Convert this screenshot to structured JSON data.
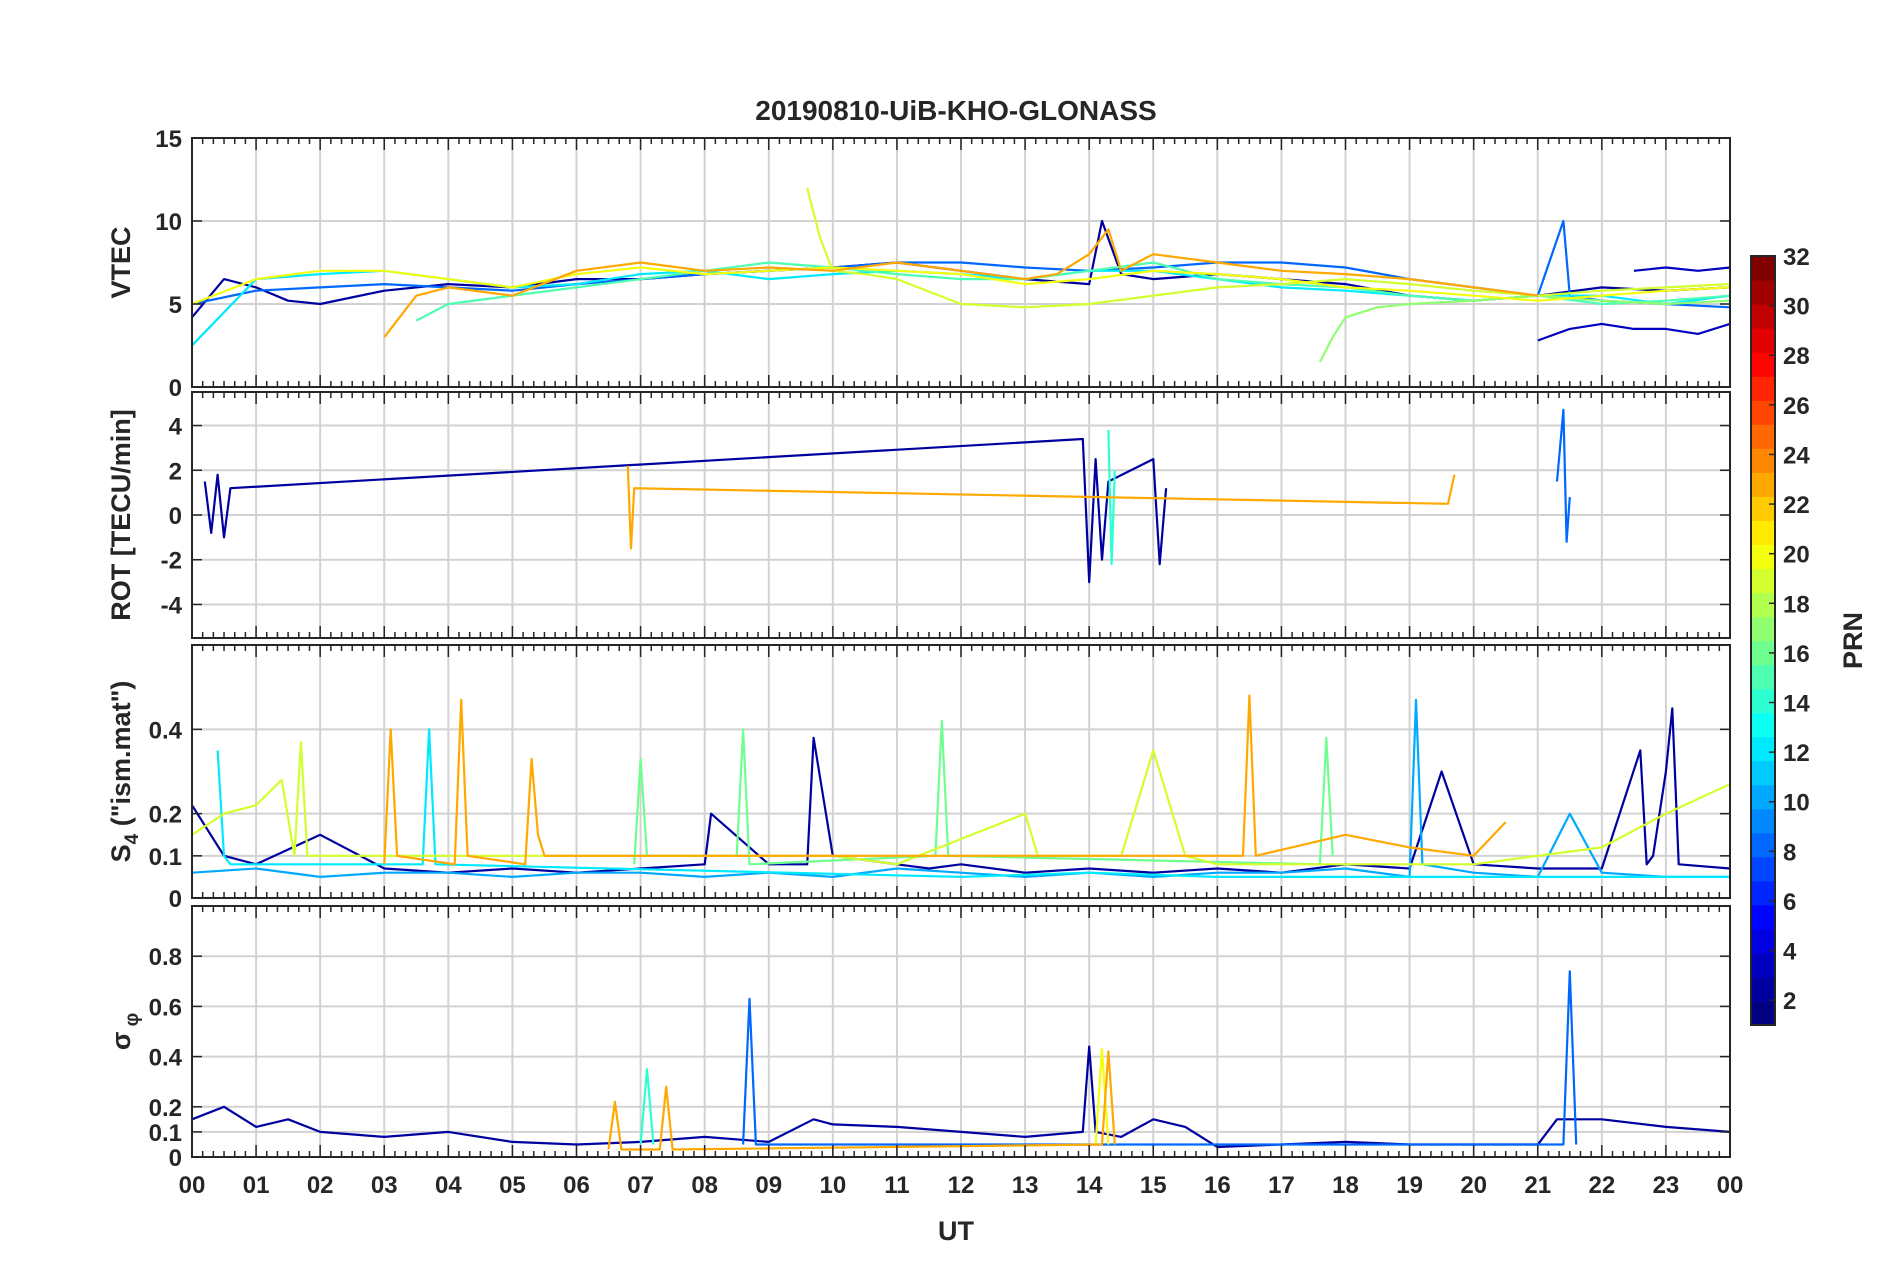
{
  "chart_data": {
    "type": "line",
    "title": "20190810-UiB-KHO-GLONASS",
    "xlabel": "UT",
    "x_ticks": [
      "00",
      "01",
      "02",
      "03",
      "04",
      "05",
      "06",
      "07",
      "08",
      "09",
      "10",
      "11",
      "12",
      "13",
      "14",
      "15",
      "16",
      "17",
      "18",
      "19",
      "20",
      "21",
      "22",
      "23",
      "00"
    ],
    "xlim": [
      0,
      24
    ],
    "grid": true,
    "colorbar": {
      "label": "PRN",
      "colormap": "jet",
      "range": [
        1,
        32
      ],
      "ticks": [
        "2",
        "4",
        "6",
        "8",
        "10",
        "12",
        "14",
        "16",
        "18",
        "20",
        "22",
        "24",
        "26",
        "28",
        "30",
        "32"
      ]
    },
    "panels": [
      {
        "id": "vtec",
        "ylabel": "VTEC",
        "ylim": [
          0,
          15
        ],
        "y_ticks": [
          "0",
          "5",
          "10",
          "15"
        ],
        "series": [
          {
            "prn": 2,
            "x": [
              0,
              0.5,
              1,
              1.5,
              2,
              3,
              4,
              5,
              6,
              7,
              8,
              9,
              10,
              11,
              12,
              13,
              14,
              14.2,
              14.5,
              15,
              16,
              17,
              18,
              19,
              20,
              21,
              22,
              23,
              24
            ],
            "y": [
              4.2,
              6.5,
              6,
              5.2,
              5,
              5.8,
              6.2,
              6,
              6.5,
              6.5,
              6.8,
              7,
              7.2,
              7.5,
              7,
              6.5,
              6.2,
              10,
              6.8,
              6.5,
              6.8,
              6.5,
              6.2,
              5.5,
              5.2,
              5.5,
              6,
              5.8,
              6
            ]
          },
          {
            "prn": 3,
            "x": [
              21,
              21.5,
              22,
              22.5,
              23,
              23.5,
              24
            ],
            "y": [
              2.8,
              3.5,
              3.8,
              3.5,
              3.5,
              3.2,
              3.8
            ]
          },
          {
            "prn": 3,
            "x": [
              22.5,
              23,
              23.5,
              24
            ],
            "y": [
              7,
              7.2,
              7,
              7.2
            ]
          },
          {
            "prn": 8,
            "x": [
              0,
              1,
              2,
              3,
              4,
              5,
              6,
              7,
              8,
              9,
              10,
              11,
              12,
              13,
              14,
              15,
              16,
              17,
              18,
              19,
              20,
              21,
              21.4,
              21.5,
              22,
              23,
              24
            ],
            "y": [
              5,
              5.8,
              6,
              6.2,
              6,
              5.8,
              6.2,
              6.5,
              6.8,
              7,
              7.2,
              7.5,
              7.5,
              7.2,
              7,
              7.2,
              7.5,
              7.5,
              7.2,
              6.5,
              6,
              5.5,
              10,
              5.5,
              5.2,
              5,
              4.8
            ]
          },
          {
            "prn": 12,
            "x": [
              0,
              0.5,
              1,
              2,
              3,
              4,
              5,
              6,
              7,
              8,
              9,
              10,
              11,
              12,
              13,
              14,
              15,
              16,
              17,
              18,
              19,
              20,
              21,
              22,
              23,
              24
            ],
            "y": [
              2.5,
              4.5,
              6.5,
              6.8,
              7,
              6.5,
              6,
              6.2,
              6.8,
              7,
              6.5,
              6.8,
              7,
              6.8,
              6.5,
              7,
              7,
              6.5,
              6,
              5.8,
              5.5,
              5.2,
              5.5,
              5.5,
              5,
              5.5
            ]
          },
          {
            "prn": 15,
            "x": [
              3.5,
              4,
              5,
              6,
              7,
              8,
              9,
              10,
              11,
              12,
              13,
              14,
              15,
              16,
              17,
              18,
              19,
              20,
              21,
              22,
              23,
              24
            ],
            "y": [
              4,
              5,
              5.5,
              6,
              6.5,
              7,
              7.5,
              7.2,
              6.8,
              6.5,
              6.5,
              7,
              7.5,
              6.5,
              6.2,
              6,
              5.5,
              5.2,
              5.5,
              5,
              5.2,
              5.5
            ]
          },
          {
            "prn": 17,
            "x": [
              17.6,
              17.8,
              18,
              18.5,
              19,
              20,
              21,
              22,
              23,
              24
            ],
            "y": [
              1.5,
              3,
              4.2,
              4.8,
              5,
              5.2,
              5.5,
              5.2,
              5,
              5.2
            ]
          },
          {
            "prn": 19,
            "x": [
              9.6,
              9.8,
              10,
              10.5,
              11,
              12,
              13,
              14,
              15,
              16,
              17,
              18,
              19,
              20,
              21,
              22,
              23,
              24
            ],
            "y": [
              12,
              9,
              7,
              6.8,
              6.5,
              5,
              4.8,
              5,
              5.5,
              6,
              6.2,
              6.5,
              6.2,
              5.8,
              5.5,
              5.8,
              6,
              6.2
            ]
          },
          {
            "prn": 20,
            "x": [
              0,
              1,
              2,
              3,
              4,
              5,
              6,
              7,
              8,
              9,
              10,
              11,
              12,
              13,
              14,
              15,
              16,
              17,
              18,
              19,
              20,
              21,
              22,
              23,
              24
            ],
            "y": [
              5,
              6.5,
              7,
              7,
              6.5,
              6,
              6.8,
              7.2,
              6.8,
              7,
              7.2,
              7,
              6.8,
              6.2,
              6.5,
              7,
              6.8,
              6.5,
              6,
              5.8,
              5.5,
              5.2,
              5.5,
              5.8,
              6
            ]
          },
          {
            "prn": 23,
            "x": [
              3,
              3.5,
              4,
              5,
              6,
              7,
              8,
              9,
              10,
              11,
              12,
              13,
              13.5,
              14,
              14.3,
              14.5,
              15,
              16,
              17,
              18,
              19,
              20,
              21
            ],
            "y": [
              3,
              5.5,
              6,
              5.5,
              7,
              7.5,
              7,
              7.2,
              7,
              7.5,
              7,
              6.5,
              6.8,
              8,
              9.5,
              7,
              8,
              7.5,
              7,
              6.8,
              6.5,
              6,
              5.5
            ]
          }
        ]
      },
      {
        "id": "rot",
        "ylabel": "ROT [TECU/min]",
        "ylim": [
          -5.5,
          5.5
        ],
        "y_ticks": [
          "-4",
          "-2",
          "0",
          "2",
          "4"
        ],
        "series": [
          {
            "prn": 2,
            "x": [
              0.2,
              0.3,
              0.4,
              0.5,
              0.6,
              13.9,
              14,
              14.1,
              14.2,
              14.3,
              15,
              15.1,
              15.2
            ],
            "y": [
              1.5,
              -0.8,
              1.8,
              -1,
              1.2,
              3.4,
              -3,
              2.5,
              -2,
              1.5,
              2.5,
              -2.2,
              1.2
            ]
          },
          {
            "prn": 8,
            "x": [
              21.3,
              21.4,
              21.45,
              21.5
            ],
            "y": [
              1.5,
              4.7,
              -1.2,
              0.8
            ]
          },
          {
            "prn": 14,
            "x": [
              14.3,
              14.35,
              14.4
            ],
            "y": [
              3.8,
              -2.2,
              2
            ]
          },
          {
            "prn": 23,
            "x": [
              6.8,
              6.85,
              6.9,
              19.6,
              19.7
            ],
            "y": [
              2.2,
              -1.5,
              1.2,
              0.5,
              1.8
            ]
          }
        ]
      },
      {
        "id": "s4",
        "ylabel": "S4 (\"ism.mat\")",
        "ylim": [
          0,
          0.6
        ],
        "y_ticks": [
          "0",
          "0.1",
          "0.2",
          "0.4"
        ],
        "series": [
          {
            "prn": 2,
            "x": [
              0,
              0.5,
              1,
              2,
              3,
              4,
              5,
              6,
              7,
              8,
              8.1,
              9,
              9.6,
              9.7,
              10,
              11,
              11.5,
              12,
              13,
              14,
              15,
              16,
              17,
              18,
              19,
              19.5,
              20,
              21,
              22,
              22.6,
              22.7,
              22.8,
              23,
              23.1,
              23.2,
              24
            ],
            "y": [
              0.22,
              0.1,
              0.08,
              0.15,
              0.07,
              0.06,
              0.07,
              0.06,
              0.07,
              0.08,
              0.2,
              0.08,
              0.08,
              0.38,
              0.1,
              0.08,
              0.07,
              0.08,
              0.06,
              0.07,
              0.06,
              0.07,
              0.06,
              0.08,
              0.07,
              0.3,
              0.08,
              0.07,
              0.07,
              0.35,
              0.08,
              0.1,
              0.3,
              0.45,
              0.08,
              0.07
            ]
          },
          {
            "prn": 10,
            "x": [
              0,
              1,
              2,
              3,
              4,
              5,
              6,
              7,
              8,
              9,
              10,
              11,
              12,
              13,
              14,
              15,
              16,
              17,
              18,
              19,
              19.1,
              19.2,
              20,
              21,
              21.5,
              22,
              23,
              24
            ],
            "y": [
              0.06,
              0.07,
              0.05,
              0.06,
              0.06,
              0.05,
              0.06,
              0.06,
              0.05,
              0.06,
              0.05,
              0.07,
              0.06,
              0.05,
              0.06,
              0.05,
              0.06,
              0.06,
              0.07,
              0.05,
              0.47,
              0.08,
              0.06,
              0.05,
              0.2,
              0.06,
              0.05,
              0.05
            ]
          },
          {
            "prn": 12,
            "x": [
              0.4,
              0.5,
              0.6,
              3.6,
              3.7,
              3.8,
              12,
              14,
              16,
              18,
              20,
              22,
              24
            ],
            "y": [
              0.35,
              0.1,
              0.08,
              0.08,
              0.4,
              0.08,
              0.05,
              0.06,
              0.05,
              0.05,
              0.05,
              0.05,
              0.05
            ]
          },
          {
            "prn": 16,
            "x": [
              6.9,
              7,
              7.1,
              8.5,
              8.6,
              8.7,
              11.6,
              11.7,
              11.8,
              17.6,
              17.7,
              17.8
            ],
            "y": [
              0.08,
              0.33,
              0.1,
              0.1,
              0.4,
              0.08,
              0.1,
              0.42,
              0.1,
              0.08,
              0.38,
              0.1
            ]
          },
          {
            "prn": 19,
            "x": [
              0,
              0.5,
              1,
              1.4,
              1.6,
              1.7,
              1.8,
              10,
              11,
              12,
              13,
              13.2,
              14.5,
              15,
              15.5,
              16,
              20,
              22,
              23,
              24
            ],
            "y": [
              0.15,
              0.2,
              0.22,
              0.28,
              0.1,
              0.37,
              0.1,
              0.1,
              0.08,
              0.14,
              0.2,
              0.1,
              0.1,
              0.35,
              0.1,
              0.08,
              0.08,
              0.12,
              0.2,
              0.27
            ]
          },
          {
            "prn": 23,
            "x": [
              3,
              3.1,
              3.2,
              4.1,
              4.2,
              4.3,
              5.2,
              5.3,
              5.4,
              5.5,
              16.4,
              16.5,
              16.6,
              18,
              19,
              20,
              20.5
            ],
            "y": [
              0.08,
              0.4,
              0.1,
              0.08,
              0.47,
              0.1,
              0.08,
              0.33,
              0.15,
              0.1,
              0.1,
              0.48,
              0.1,
              0.15,
              0.12,
              0.1,
              0.18
            ]
          }
        ]
      },
      {
        "id": "sigma_phi",
        "ylabel": "σφ",
        "ylim": [
          0,
          1
        ],
        "y_ticks": [
          "0",
          "0.1",
          "0.2",
          "0.4",
          "0.6",
          "0.8"
        ],
        "series": [
          {
            "prn": 2,
            "x": [
              0,
              0.5,
              1,
              1.5,
              2,
              3,
              4,
              5,
              6,
              7,
              8,
              9,
              9.7,
              10,
              11,
              12,
              13,
              13.9,
              14,
              14.1,
              14.5,
              15,
              15.5,
              16,
              17,
              18,
              19,
              20,
              21,
              21.3,
              22,
              23,
              24
            ],
            "y": [
              0.15,
              0.2,
              0.12,
              0.15,
              0.1,
              0.08,
              0.1,
              0.06,
              0.05,
              0.06,
              0.08,
              0.06,
              0.15,
              0.13,
              0.12,
              0.1,
              0.08,
              0.1,
              0.44,
              0.1,
              0.08,
              0.15,
              0.12,
              0.04,
              0.05,
              0.06,
              0.05,
              0.05,
              0.05,
              0.15,
              0.15,
              0.12,
              0.1
            ]
          },
          {
            "prn": 8,
            "x": [
              8.6,
              8.7,
              8.8,
              21.4,
              21.5,
              21.6
            ],
            "y": [
              0.05,
              0.63,
              0.05,
              0.05,
              0.74,
              0.05
            ]
          },
          {
            "prn": 14,
            "x": [
              7,
              7.1,
              7.2
            ],
            "y": [
              0.05,
              0.35,
              0.05
            ]
          },
          {
            "prn": 20,
            "x": [
              14.1,
              14.2,
              14.3
            ],
            "y": [
              0.05,
              0.43,
              0.05
            ]
          },
          {
            "prn": 23,
            "x": [
              6.5,
              6.6,
              6.7,
              7.3,
              7.4,
              7.5,
              14.2,
              14.3,
              14.4
            ],
            "y": [
              0.03,
              0.22,
              0.03,
              0.03,
              0.28,
              0.03,
              0.05,
              0.42,
              0.05
            ]
          }
        ]
      }
    ]
  }
}
